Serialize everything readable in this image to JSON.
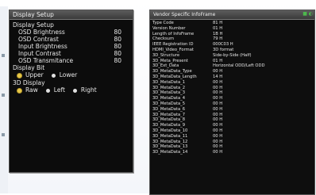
{
  "left_panel": {
    "title": "Display Setup",
    "section_setup": "Display Setup",
    "settings": [
      {
        "label": "OSD Brightness",
        "value": "80"
      },
      {
        "label": "OSD Contrast",
        "value": "80"
      },
      {
        "label": "Input Brightness",
        "value": "80"
      },
      {
        "label": "Input Contrast",
        "value": "80"
      },
      {
        "label": "OSD Transmitance",
        "value": "80"
      }
    ],
    "section_bit": "Display Bit",
    "bit_options": [
      "Upper",
      "Lower"
    ],
    "bit_selected": "Upper",
    "section_3d": "3D Display",
    "d3_options": [
      "Raw",
      "Left",
      "Right"
    ],
    "d3_selected": "Raw"
  },
  "right_panel": {
    "title": "Vendor Specific InfoFrame",
    "rows": [
      {
        "key": "Type Code",
        "value": "81 H"
      },
      {
        "key": "Version Number",
        "value": "01 H"
      },
      {
        "key": "Length of InfoFrame",
        "value": "1B H"
      },
      {
        "key": "Checksum",
        "value": "79 H"
      },
      {
        "key": "IEEE Registration ID",
        "value": "000C03 H"
      },
      {
        "key": "HDMI_Video_Format",
        "value": "3D format"
      },
      {
        "key": "3D_Structure",
        "value": "Side-by-Side (Half)"
      },
      {
        "key": "3D_Meta_Present",
        "value": "01 H"
      },
      {
        "key": "3D_Ext_Data",
        "value": "Horizontal ODD/Left ODD"
      },
      {
        "key": "3D_MetaData_Type",
        "value": "00 H"
      },
      {
        "key": "3D_MetaData_Length",
        "value": "14 H"
      },
      {
        "key": "3D_MetaData_1",
        "value": "00 H"
      },
      {
        "key": "3D_MetaData_2",
        "value": "00 H"
      },
      {
        "key": "3D_MetaData_3",
        "value": "00 H"
      },
      {
        "key": "3D_MetaData_4",
        "value": "00 H"
      },
      {
        "key": "3D_MetaData_5",
        "value": "00 H"
      },
      {
        "key": "3D_MetaData_6",
        "value": "00 H"
      },
      {
        "key": "3D_MetaData_7",
        "value": "00 H"
      },
      {
        "key": "3D_MetaData_8",
        "value": "00 H"
      },
      {
        "key": "3D_MetaData_9",
        "value": "00 H"
      },
      {
        "key": "3D_MetaData_10",
        "value": "00 H"
      },
      {
        "key": "3D_MetaData_11",
        "value": "00 H"
      },
      {
        "key": "3D_MetaData_12",
        "value": "00 H"
      },
      {
        "key": "3D_MetaData_13",
        "value": "00 H"
      },
      {
        "key": "3D_MetaData_14",
        "value": "00 H"
      }
    ]
  }
}
